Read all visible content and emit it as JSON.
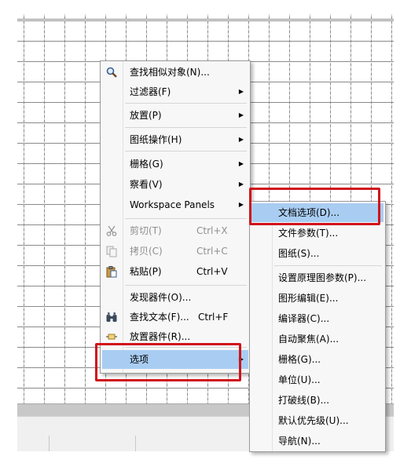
{
  "main_menu": {
    "items": [
      {
        "label": "查找相似对象(N)...",
        "icon": "search-icon"
      },
      {
        "label": "过滤器(F)",
        "submenu": true
      },
      {
        "label": "放置(P)",
        "submenu": true
      },
      {
        "label": "图纸操作(H)",
        "submenu": true
      },
      {
        "label": "栅格(G)",
        "submenu": true
      },
      {
        "label": "察看(V)",
        "submenu": true
      },
      {
        "label": "Workspace Panels",
        "submenu": true
      },
      {
        "label": "剪切(T)",
        "shortcut": "Ctrl+X",
        "disabled": true,
        "icon": "scissors-icon"
      },
      {
        "label": "拷贝(C)",
        "shortcut": "Ctrl+C",
        "disabled": true,
        "icon": "copy-icon"
      },
      {
        "label": "粘贴(P)",
        "shortcut": "Ctrl+V",
        "icon": "paste-icon"
      },
      {
        "label": "发现器件(O)..."
      },
      {
        "label": "查找文本(F)...",
        "shortcut": "Ctrl+F",
        "icon": "binoculars-icon"
      },
      {
        "label": "放置器件(R)...",
        "icon": "place-part-icon"
      },
      {
        "label": "选项",
        "submenu": true,
        "highlighted": true
      }
    ]
  },
  "sub_menu": {
    "items": [
      {
        "label": "文档选项(D)...",
        "highlighted": true
      },
      {
        "label": "文件参数(T)..."
      },
      {
        "label": "图纸(S)..."
      },
      {
        "label": "设置原理图参数(P)..."
      },
      {
        "label": "图形编辑(E)..."
      },
      {
        "label": "编译器(C)..."
      },
      {
        "label": "自动聚焦(A)..."
      },
      {
        "label": "栅格(G)..."
      },
      {
        "label": "单位(U)..."
      },
      {
        "label": "打破线(B)..."
      },
      {
        "label": "默认优先级(U)..."
      },
      {
        "label": "导航(N)..."
      }
    ]
  },
  "colors": {
    "highlight": "#a9cdf2",
    "annotation_red": "#d0121b"
  }
}
